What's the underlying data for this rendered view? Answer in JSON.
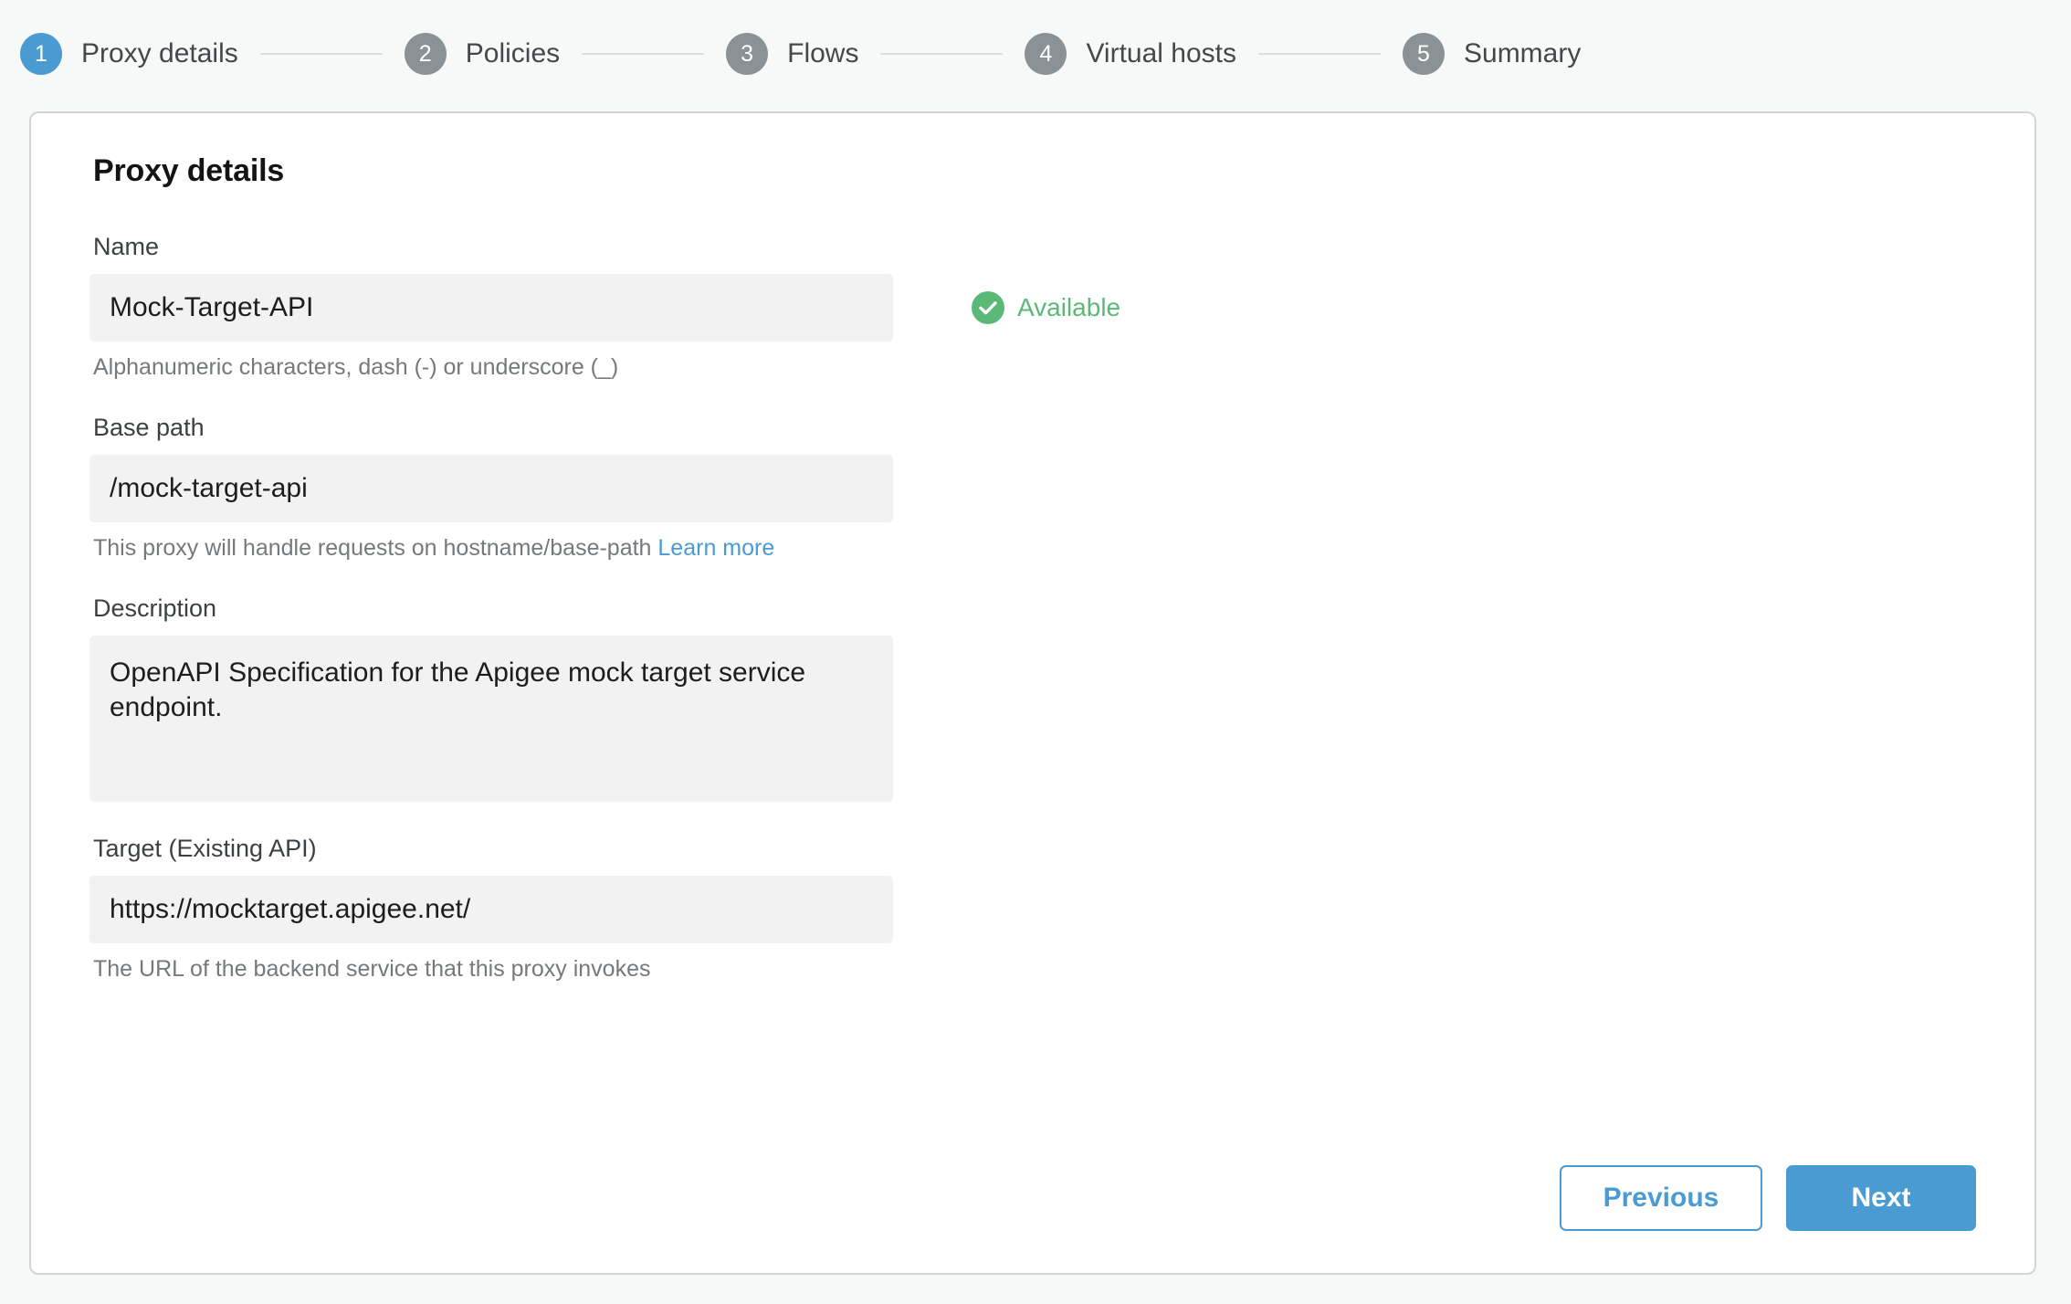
{
  "stepper": {
    "steps": [
      {
        "number": "1",
        "label": "Proxy details",
        "active": true
      },
      {
        "number": "2",
        "label": "Policies",
        "active": false
      },
      {
        "number": "3",
        "label": "Flows",
        "active": false
      },
      {
        "number": "4",
        "label": "Virtual hosts",
        "active": false
      },
      {
        "number": "5",
        "label": "Summary",
        "active": false
      }
    ],
    "active_color": "#4a9bd1",
    "inactive_color": "#8a9296"
  },
  "card": {
    "title": "Proxy details",
    "fields": {
      "name": {
        "label": "Name",
        "value": "Mock-Target-API",
        "helper": "Alphanumeric characters, dash (-) or underscore (_)",
        "status_text": "Available",
        "status_icon": "check-circle-icon",
        "status_color": "#5bb978"
      },
      "base_path": {
        "label": "Base path",
        "value": "/mock-target-api",
        "helper": "This proxy will handle requests on hostname/base-path",
        "helper_link": "Learn more",
        "link_color": "#4a9bd1"
      },
      "description": {
        "label": "Description",
        "value": "OpenAPI Specification for the Apigee mock target service endpoint."
      },
      "target": {
        "label": "Target (Existing API)",
        "value": "https://mocktarget.apigee.net/",
        "helper": "The URL of the backend service that this proxy invokes"
      }
    },
    "footer": {
      "previous_label": "Previous",
      "next_label": "Next"
    }
  }
}
